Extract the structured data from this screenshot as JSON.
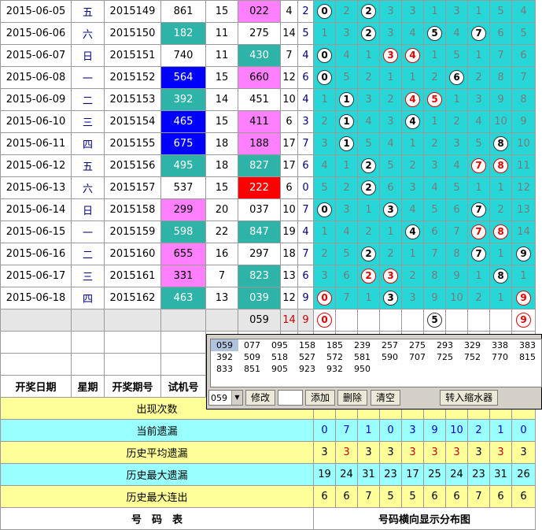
{
  "columns": {
    "date": "开奖日期",
    "weekday": "星期",
    "issue": "开奖期号",
    "trial": "试机号"
  },
  "rows": [
    {
      "date": "2015-06-05",
      "weekday": "五",
      "issue": "2015149",
      "trial": "861",
      "n5": "15",
      "draw": "022",
      "sum": "4",
      "span": "2",
      "trial_bg": "none",
      "draw_bg": "pink",
      "dist": [
        "0*",
        "2",
        "2*",
        "3",
        "3",
        "1",
        "3",
        "1",
        "5",
        "4"
      ]
    },
    {
      "date": "2015-06-06",
      "weekday": "六",
      "issue": "2015150",
      "trial": "182",
      "n5": "11",
      "draw": "275",
      "sum": "14",
      "span": "5",
      "trial_bg": "teal",
      "draw_bg": "none",
      "dist": [
        "1",
        "3",
        "2*",
        "3",
        "4",
        "5*",
        "4",
        "7*",
        "6",
        "5"
      ]
    },
    {
      "date": "2015-06-07",
      "weekday": "日",
      "issue": "2015151",
      "trial": "740",
      "n5": "11",
      "draw": "430",
      "sum": "7",
      "span": "4",
      "trial_bg": "none",
      "draw_bg": "teal",
      "dist": [
        "0*",
        "4",
        "1",
        "3r",
        "4r",
        "1",
        "5",
        "1",
        "7",
        "6"
      ]
    },
    {
      "date": "2015-06-08",
      "weekday": "一",
      "issue": "2015152",
      "trial": "564",
      "n5": "15",
      "draw": "660",
      "sum": "12",
      "span": "6",
      "trial_bg": "blue",
      "draw_bg": "pink",
      "dist": [
        "0*",
        "5",
        "2",
        "1",
        "1",
        "2",
        "6*",
        "2",
        "8",
        "7"
      ]
    },
    {
      "date": "2015-06-09",
      "weekday": "二",
      "issue": "2015153",
      "trial": "392",
      "n5": "14",
      "draw": "451",
      "sum": "10",
      "span": "4",
      "trial_bg": "teal",
      "draw_bg": "none",
      "dist": [
        "1",
        "1*",
        "3",
        "2",
        "4r",
        "5r",
        "1",
        "3",
        "9",
        "8"
      ]
    },
    {
      "date": "2015-06-10",
      "weekday": "三",
      "issue": "2015154",
      "trial": "465",
      "n5": "15",
      "draw": "411",
      "sum": "6",
      "span": "3",
      "trial_bg": "blue",
      "draw_bg": "pink",
      "dist": [
        "2",
        "1*",
        "4",
        "3",
        "4*",
        "1",
        "2",
        "4",
        "10",
        "9"
      ]
    },
    {
      "date": "2015-06-11",
      "weekday": "四",
      "issue": "2015155",
      "trial": "675",
      "n5": "18",
      "draw": "188",
      "sum": "17",
      "span": "7",
      "trial_bg": "blue",
      "draw_bg": "pink",
      "dist": [
        "3",
        "1*",
        "5",
        "4",
        "1",
        "2",
        "3",
        "5",
        "8*",
        "10"
      ]
    },
    {
      "date": "2015-06-12",
      "weekday": "五",
      "issue": "2015156",
      "trial": "495",
      "n5": "18",
      "draw": "827",
      "sum": "17",
      "span": "6",
      "trial_bg": "teal",
      "draw_bg": "teal",
      "dist": [
        "4",
        "1",
        "2*",
        "5",
        "2",
        "3",
        "4",
        "7r",
        "8r",
        "11"
      ]
    },
    {
      "date": "2015-06-13",
      "weekday": "六",
      "issue": "2015157",
      "trial": "537",
      "n5": "15",
      "draw": "222",
      "sum": "6",
      "span": "0",
      "trial_bg": "none",
      "draw_bg": "red",
      "dist": [
        "5",
        "2",
        "2*",
        "6",
        "3",
        "4",
        "5",
        "1",
        "1",
        "12"
      ]
    },
    {
      "date": "2015-06-14",
      "weekday": "日",
      "issue": "2015158",
      "trial": "299",
      "n5": "20",
      "draw": "037",
      "sum": "10",
      "span": "7",
      "trial_bg": "pink",
      "draw_bg": "none",
      "dist": [
        "0*",
        "3",
        "1",
        "3*",
        "4",
        "5",
        "6",
        "7*",
        "2",
        "13"
      ]
    },
    {
      "date": "2015-06-15",
      "weekday": "一",
      "issue": "2015159",
      "trial": "598",
      "n5": "22",
      "draw": "847",
      "sum": "19",
      "span": "4",
      "trial_bg": "teal",
      "draw_bg": "teal",
      "dist": [
        "1",
        "4",
        "2",
        "1",
        "4*",
        "6",
        "7",
        "7r",
        "8r",
        "14"
      ]
    },
    {
      "date": "2015-06-16",
      "weekday": "二",
      "issue": "2015160",
      "trial": "655",
      "n5": "16",
      "draw": "297",
      "sum": "18",
      "span": "7",
      "trial_bg": "pink",
      "draw_bg": "none",
      "dist": [
        "2",
        "5",
        "2*",
        "2",
        "1",
        "7",
        "8",
        "7*",
        "1",
        "9*"
      ]
    },
    {
      "date": "2015-06-17",
      "weekday": "三",
      "issue": "2015161",
      "trial": "331",
      "n5": "7",
      "draw": "823",
      "sum": "13",
      "span": "6",
      "trial_bg": "pink",
      "draw_bg": "teal",
      "dist": [
        "3",
        "6",
        "2r",
        "3r",
        "2",
        "8",
        "9",
        "1",
        "8*",
        "1"
      ]
    },
    {
      "date": "2015-06-18",
      "weekday": "四",
      "issue": "2015162",
      "trial": "463",
      "n5": "13",
      "draw": "039",
      "sum": "12",
      "span": "9",
      "trial_bg": "teal",
      "draw_bg": "teal",
      "dist": [
        "0r",
        "7",
        "1",
        "3*",
        "3",
        "9",
        "10",
        "2",
        "1",
        "9r"
      ]
    }
  ],
  "trial_row": {
    "draw": "059",
    "sum": "14",
    "span": "9",
    "balls": {
      "0": "0r",
      "5": "5*",
      "9": "9r"
    }
  },
  "panel": {
    "list": [
      [
        "059",
        "077",
        "095",
        "158",
        "185",
        "239",
        "257",
        "275",
        "293",
        "329",
        "338",
        "383"
      ],
      [
        "392",
        "509",
        "518",
        "527",
        "572",
        "581",
        "590",
        "707",
        "725",
        "752",
        "770",
        "815"
      ],
      [
        "833",
        "851",
        "905",
        "923",
        "932",
        "950"
      ]
    ],
    "selected_value": "059",
    "buttons": {
      "modify": "修改",
      "add": "添加",
      "delete": "删除",
      "clear": "清空",
      "shrink": "转入缩水器"
    }
  },
  "stats": [
    {
      "label": "出现次数",
      "values": [
        "",
        "",
        "",
        "",
        "",
        "",
        "",
        "",
        "",
        ""
      ],
      "cls": "y1"
    },
    {
      "label": "当前遗漏",
      "values": [
        "0",
        "7",
        "1",
        "0",
        "3",
        "9",
        "10",
        "2",
        "1",
        "0"
      ],
      "cls": "c1"
    },
    {
      "label": "历史平均遗漏",
      "values": [
        "3",
        "3",
        "3",
        "3",
        "3",
        "3",
        "3",
        "3",
        "3",
        "3"
      ],
      "cls": "y2"
    },
    {
      "label": "历史最大遗漏",
      "values": [
        "19",
        "24",
        "31",
        "23",
        "17",
        "25",
        "24",
        "23",
        "31",
        "26"
      ],
      "cls": "c2"
    },
    {
      "label": "历史最大连出",
      "values": [
        "6",
        "6",
        "7",
        "5",
        "5",
        "6",
        "6",
        "7",
        "6",
        "6"
      ],
      "cls": "y3"
    }
  ],
  "footer": {
    "left": "号　码　表",
    "right": "号码横向显示分布图"
  }
}
